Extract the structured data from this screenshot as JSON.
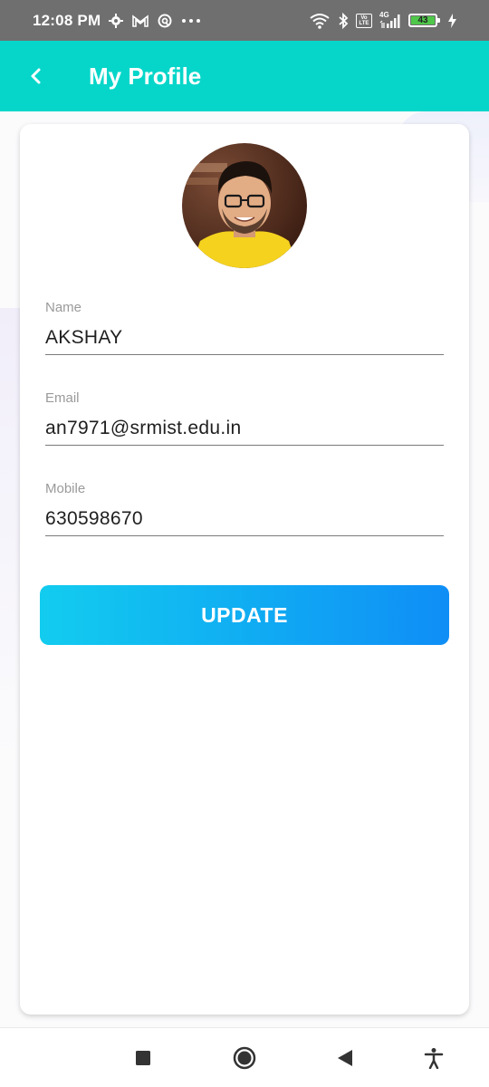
{
  "status_bar": {
    "time": "12:08 PM",
    "battery_level": "43",
    "left_icons": [
      "settings-icon",
      "gmail-icon",
      "vpn-icon",
      "more-dots-icon"
    ],
    "right_icons": [
      "wifi-icon",
      "bluetooth-icon",
      "volte-icon",
      "signal-4g-icon",
      "battery-icon",
      "charging-icon"
    ],
    "network_label": "4G",
    "volte_label": "Vo LTE"
  },
  "app_bar": {
    "title": "My Profile",
    "background_color": "#06d6c9"
  },
  "profile": {
    "fields": [
      {
        "label": "Name",
        "value": "AKSHAY"
      },
      {
        "label": "Email",
        "value": "an7971@srmist.edu.in"
      },
      {
        "label": "Mobile",
        "value": "630598670"
      }
    ],
    "update_label": "UPDATE"
  },
  "nav_bar": {
    "buttons": [
      "recents-square-icon",
      "home-circle-icon",
      "back-triangle-icon",
      "accessibility-icon"
    ]
  }
}
